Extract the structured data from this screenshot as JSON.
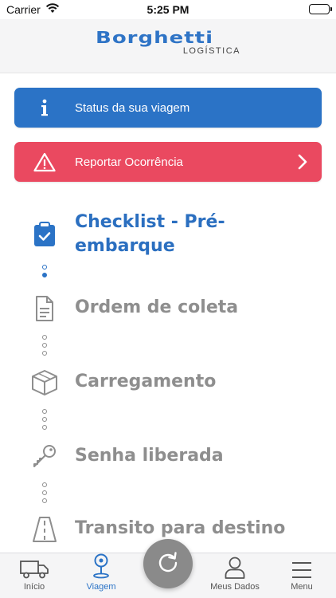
{
  "status_bar": {
    "carrier": "Carrier",
    "time": "5:25 PM"
  },
  "header": {
    "logo_brand": "Borghetti",
    "logo_sub": "LOGÍSTICA"
  },
  "actions": {
    "status_label": "Status da sua viagem",
    "report_label": "Reportar Ocorrência"
  },
  "steps": [
    {
      "label": "Checklist - Pré-embarque",
      "icon": "clipboard-check-icon",
      "active": true
    },
    {
      "label": "Ordem de coleta",
      "icon": "document-icon",
      "active": false
    },
    {
      "label": "Carregamento",
      "icon": "box-icon",
      "active": false
    },
    {
      "label": "Senha liberada",
      "icon": "key-icon",
      "active": false
    },
    {
      "label": "Transito para destino",
      "icon": "road-icon",
      "active": false
    }
  ],
  "tabs": [
    {
      "label": "Início",
      "icon": "truck-icon",
      "active": false
    },
    {
      "label": "Viagem",
      "icon": "map-pin-icon",
      "active": true
    },
    {
      "label": "Meus Dados",
      "icon": "user-icon",
      "active": false
    },
    {
      "label": "Menu",
      "icon": "hamburger-icon",
      "active": false
    }
  ],
  "fab_icon": "refresh-icon",
  "colors": {
    "primary": "#2b73c6",
    "danger": "#ea4960",
    "inactive": "#8e8e8e",
    "fab": "#8a8a8a"
  }
}
